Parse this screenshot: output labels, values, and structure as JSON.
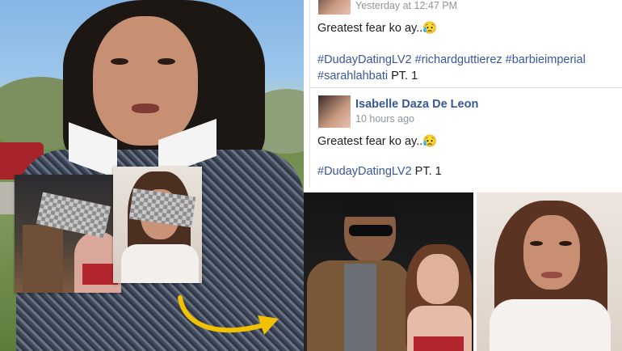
{
  "posts": [
    {
      "timestamp": "Yesterday at 12:47 PM",
      "text": "Greatest fear ko ay..",
      "emoji": "😥",
      "hashtags_line1": "#DudayDatingLV2 #richardguttierez #barbieimperial",
      "hashtags_line2": "#sarahlahbati",
      "suffix": " PT. 1"
    },
    {
      "author": "Isabelle Daza De Leon",
      "timestamp": "10 hours ago",
      "text": "Greatest fear ko ay..",
      "emoji": "😥",
      "hashtags_line1": "#DudayDatingLV2",
      "suffix": " PT. 1"
    }
  ],
  "colors": {
    "link": "#385898",
    "arrow": "#f2c200",
    "meta": "#90949c"
  },
  "icons": {
    "arrow": "curved-arrow-icon"
  }
}
